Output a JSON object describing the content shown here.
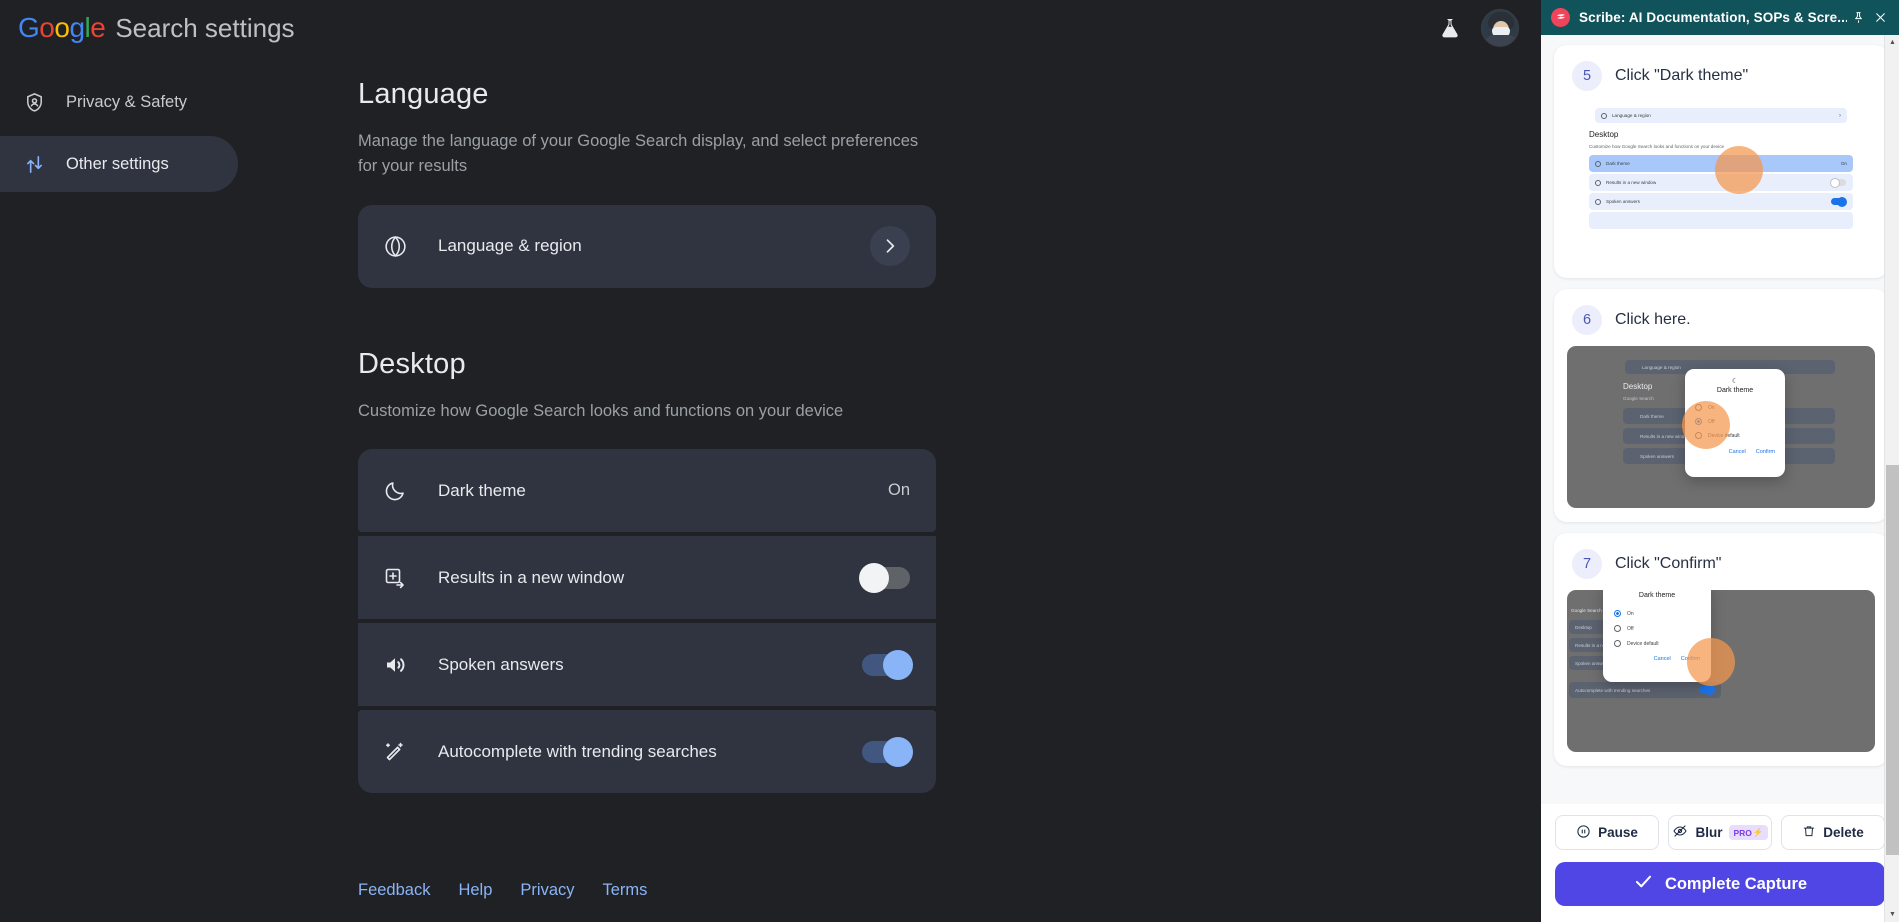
{
  "google": {
    "logo_letters": [
      "G",
      "o",
      "o",
      "g",
      "l",
      "e"
    ],
    "title": "Search settings",
    "labs_icon": "flask-icon",
    "avatar_icon": "account-avatar",
    "sidebar": {
      "items": [
        {
          "label": "Privacy & Safety",
          "icon": "shield-person-icon",
          "active": false
        },
        {
          "label": "Other settings",
          "icon": "tune-sliders-icon",
          "active": true
        }
      ]
    },
    "sections": [
      {
        "heading": "Language",
        "description": "Manage the language of your Google Search display, and select preferences for your results",
        "rows": [
          {
            "label": "Language & region",
            "icon": "globe-icon",
            "control": "chevron",
            "value": ""
          }
        ]
      },
      {
        "heading": "Desktop",
        "description": "Customize how Google Search looks and functions on your device",
        "rows": [
          {
            "label": "Dark theme",
            "icon": "moon-icon",
            "control": "value",
            "value": "On"
          },
          {
            "label": "Results in a new window",
            "icon": "open-in-new-icon",
            "control": "toggle",
            "value": "off"
          },
          {
            "label": "Spoken answers",
            "icon": "speaker-icon",
            "control": "toggle",
            "value": "on"
          },
          {
            "label": "Autocomplete with trending searches",
            "icon": "magic-wand-icon",
            "control": "toggle",
            "value": "on"
          }
        ]
      }
    ],
    "footer_links": [
      "Feedback",
      "Help",
      "Privacy",
      "Terms"
    ]
  },
  "scribe": {
    "window_title": "Scribe: AI Documentation, SOPs & Scre...",
    "logo_icon": "scribe-logo-icon",
    "pin_icon": "pin-icon",
    "close_icon": "close-icon",
    "steps": [
      {
        "number": "5",
        "text": "Click \"Dark theme\""
      },
      {
        "number": "6",
        "text": "Click here."
      },
      {
        "number": "7",
        "text": "Click \"Confirm\""
      }
    ],
    "mini": {
      "language_region": "Language & region",
      "desktop_heading": "Desktop",
      "desktop_sub": "Customize how Google Search looks and functions on your device",
      "dark_theme": "Dark theme",
      "dark_theme_value": "On",
      "results_new_window": "Results in a new window",
      "spoken_answers": "Spoken answers",
      "autocomplete": "Autocomplete with trending searches",
      "dialog_title": "Dark theme",
      "opt_on": "On",
      "opt_off": "Off",
      "opt_device": "Device default",
      "btn_cancel": "Cancel",
      "btn_confirm": "Confirm",
      "google_search_frag": "Google Search"
    },
    "actions": [
      {
        "label": "Pause",
        "icon": "pause-circle-icon",
        "badge": ""
      },
      {
        "label": "Blur",
        "icon": "eye-off-icon",
        "badge": "PRO"
      },
      {
        "label": "Delete",
        "icon": "trash-icon",
        "badge": ""
      }
    ],
    "cta": {
      "label": "Complete Capture",
      "icon": "check-icon"
    },
    "colors": {
      "header_bg": "#10535a",
      "cta_bg": "#4f46e5",
      "logo_bg": "#f0445a",
      "pro_bg": "#e9ddfd",
      "pro_fg": "#7b3fe4"
    }
  }
}
